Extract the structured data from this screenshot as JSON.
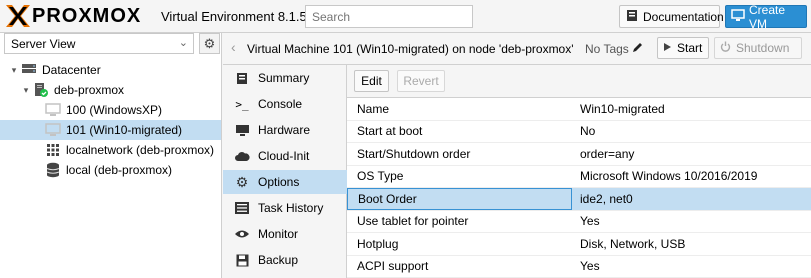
{
  "header": {
    "logo_text": "PROXMOX",
    "version": "Virtual Environment 8.1.5",
    "search_placeholder": "Search",
    "documentation_label": "Documentation",
    "create_vm_label": "Create VM",
    "icons": [
      "proxmox-x-logo-icon",
      "book-icon",
      "monitor-icon"
    ],
    "colors": {
      "logo_orange": "#e57000",
      "create_vm": "#2b8fd3"
    }
  },
  "sidebar": {
    "view_label": "Server View",
    "tree": [
      {
        "label": "Datacenter",
        "icon": "datacenter-icon",
        "expanded": true
      },
      {
        "label": "deb-proxmox",
        "icon": "server-online-icon",
        "expanded": true
      },
      {
        "label": "100 (WindowsXP)",
        "icon": "vm-stopped-icon"
      },
      {
        "label": "101 (Win10-migrated)",
        "icon": "vm-stopped-icon",
        "selected": true
      },
      {
        "label": "localnetwork (deb-proxmox)",
        "icon": "network-grid-icon"
      },
      {
        "label": "local (deb-proxmox)",
        "icon": "storage-icon"
      }
    ]
  },
  "vm": {
    "title": "Virtual Machine 101 (Win10-migrated) on node 'deb-proxmox'",
    "tags_label": "No Tags",
    "start_label": "Start",
    "shutdown_label": "Shutdown"
  },
  "nav": {
    "items": [
      {
        "label": "Summary",
        "icon": "book-icon"
      },
      {
        "label": "Console",
        "icon": "terminal-icon"
      },
      {
        "label": "Hardware",
        "icon": "desktop-icon"
      },
      {
        "label": "Cloud-Init",
        "icon": "cloud-icon"
      },
      {
        "label": "Options",
        "icon": "gear-icon",
        "selected": true
      },
      {
        "label": "Task History",
        "icon": "list-icon"
      },
      {
        "label": "Monitor",
        "icon": "eye-icon"
      },
      {
        "label": "Backup",
        "icon": "floppy-icon"
      }
    ]
  },
  "options": {
    "edit_label": "Edit",
    "revert_label": "Revert",
    "rows": [
      {
        "key": "Name",
        "value": "Win10-migrated"
      },
      {
        "key": "Start at boot",
        "value": "No"
      },
      {
        "key": "Start/Shutdown order",
        "value": "order=any"
      },
      {
        "key": "OS Type",
        "value": "Microsoft Windows 10/2016/2019"
      },
      {
        "key": "Boot Order",
        "value": "ide2, net0",
        "selected": true
      },
      {
        "key": "Use tablet for pointer",
        "value": "Yes"
      },
      {
        "key": "Hotplug",
        "value": "Disk, Network, USB"
      },
      {
        "key": "ACPI support",
        "value": "Yes"
      }
    ]
  }
}
